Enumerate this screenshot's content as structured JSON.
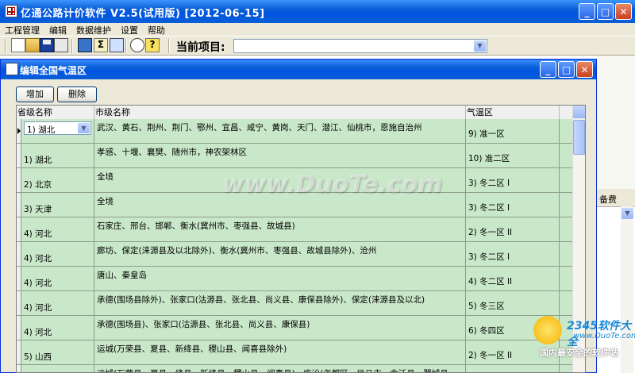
{
  "app": {
    "title": "亿通公路计价软件 V2.5(试用版) [2012-06-15]",
    "menu": [
      "工程管理",
      "编辑",
      "数据维护",
      "设置",
      "帮助"
    ],
    "current_project_label": "当前项目:",
    "current_project_value": ""
  },
  "dialog": {
    "title": "编辑全国气温区",
    "add_label": "增加",
    "delete_label": "删除",
    "columns": [
      "省级名称",
      "市级名称",
      "气温区"
    ],
    "rows": [
      {
        "prov": "1) 湖北",
        "city": "武汉、黄石、荆州、荆门、鄂州、宜昌、咸宁、黄岗、天门、潜江、仙桃市，恩施自治州",
        "zone": "9) 准一区"
      },
      {
        "prov": "1) 湖北",
        "city": "孝感、十堰、襄樊、随州市，神农架林区",
        "zone": "10) 准二区"
      },
      {
        "prov": "2) 北京",
        "city": "全境",
        "zone": "3) 冬二区 I"
      },
      {
        "prov": "3) 天津",
        "city": "全境",
        "zone": "3) 冬二区 I"
      },
      {
        "prov": "4) 河北",
        "city": "石家庄、邢台、邯郸、衡水(冀州市、枣强县、故城县)",
        "zone": "2) 冬一区 II"
      },
      {
        "prov": "4) 河北",
        "city": "廊坊、保定(涞源县及以北除外)、衡水(冀州市、枣强县、故城县除外)、沧州",
        "zone": "3) 冬二区 I"
      },
      {
        "prov": "4) 河北",
        "city": "唐山、秦皇岛",
        "zone": "4) 冬二区 II"
      },
      {
        "prov": "4) 河北",
        "city": "承德(围场县除外)、张家口(沽源县、张北县、尚义县、康保县除外)、保定(涞源县及以北)",
        "zone": "5) 冬三区"
      },
      {
        "prov": "4) 河北",
        "city": "承德(围场县)、张家口(沽源县、张北县、尚义县、康保县)",
        "zone": "6) 冬四区"
      },
      {
        "prov": "5) 山西",
        "city": "运城(万荣县、夏县、新绛县、稷山县、闻喜县除外)",
        "zone": "2) 冬一区 II"
      },
      {
        "prov": "",
        "city": "运城(万荣县、夏县、绛县、新绛县、稷山县、闻喜县)、临汾(尧都区、侯马市、曲沃县、翼城县、",
        "zone": ""
      }
    ]
  },
  "background": {
    "fee_label": "备费"
  },
  "watermark": {
    "text": "www.DuoTe.com",
    "logo_number": "2345软件大全",
    "logo_url": "www.DuoTe.com",
    "logo_slogan": "国内最安全的软件站"
  }
}
